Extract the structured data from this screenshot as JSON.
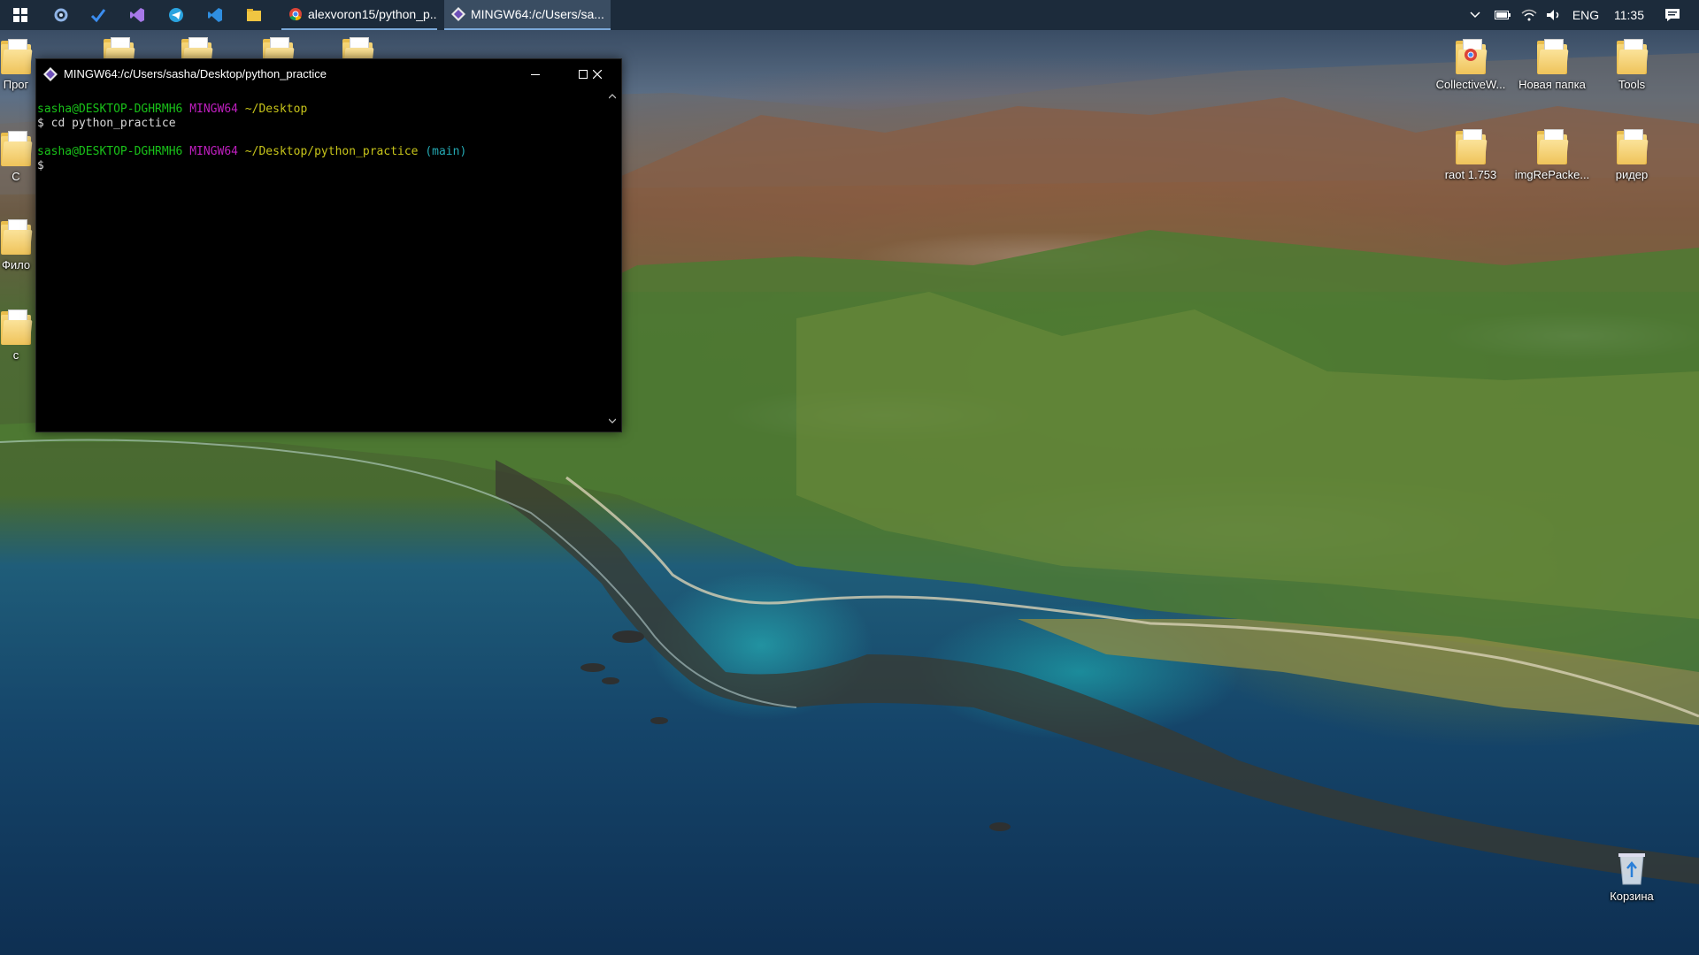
{
  "taskbar": {
    "apps": [
      {
        "label": "alexvoron15/python_p...",
        "icon": "chrome-icon"
      },
      {
        "label": "MINGW64:/c/Users/sa...",
        "icon": "git-bash-icon"
      }
    ],
    "language": "ENG",
    "time": "11:35"
  },
  "desktop_icons": {
    "left": [
      "Прог",
      "С",
      "Фило",
      "с"
    ],
    "right": [
      {
        "label": "CollectiveW...",
        "icon": "chrome-folder-icon"
      },
      {
        "label": "Новая папка",
        "icon": "folder-icon"
      },
      {
        "label": "Tools",
        "icon": "folder-icon"
      },
      {
        "label": "raot 1.753",
        "icon": "folder-icon"
      },
      {
        "label": "imgRePacke...",
        "icon": "folder-icon"
      },
      {
        "label": "ридер",
        "icon": "folder-icon"
      }
    ],
    "recycle": "Корзина"
  },
  "terminal": {
    "title": "MINGW64:/c/Users/sasha/Desktop/python_practice",
    "lines": {
      "l1_user": "sasha@DESKTOP-DGHRMH6",
      "l1_sys": "MINGW64",
      "l1_path": "~/Desktop",
      "l2": "$ cd python_practice",
      "l3_user": "sasha@DESKTOP-DGHRMH6",
      "l3_sys": "MINGW64",
      "l3_path": "~/Desktop/python_practice",
      "l3_branch": "(main)",
      "l4": "$"
    }
  },
  "colors": {
    "taskbar": "#1c2b3b",
    "prompt_user": "#19c219",
    "prompt_sys": "#c01fc0",
    "prompt_path": "#c7c41a",
    "prompt_branch": "#24a9b3"
  }
}
